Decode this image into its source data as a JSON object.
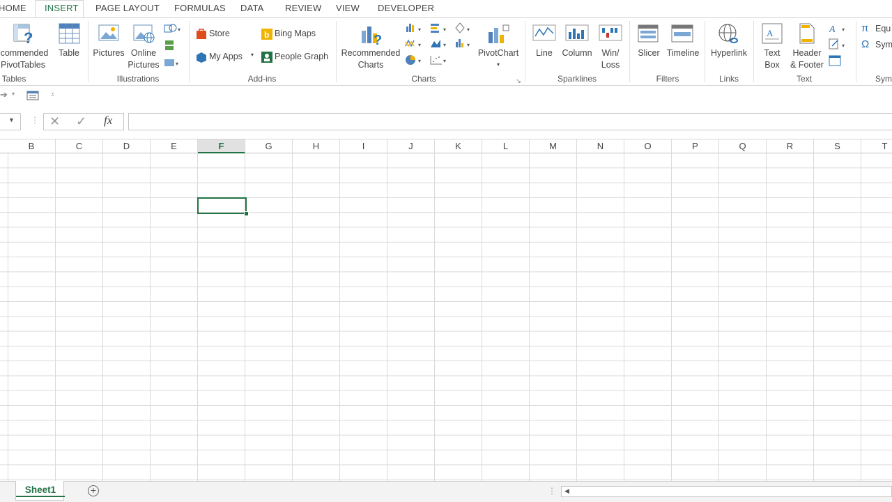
{
  "tabs": [
    "HOME",
    "INSERT",
    "PAGE LAYOUT",
    "FORMULAS",
    "DATA",
    "REVIEW",
    "VIEW",
    "DEVELOPER"
  ],
  "active_tab": "INSERT",
  "colors": {
    "accent": "#217346",
    "ribbon_bg": "#ffffff",
    "grid_line": "#dadada"
  },
  "ribbon": {
    "tables": {
      "label": "Tables",
      "recommended_pivot": [
        "commended",
        "PivotTables"
      ],
      "table": "Table"
    },
    "illustrations": {
      "label": "Illustrations",
      "pictures": "Pictures",
      "online_pictures": [
        "Online",
        "Pictures"
      ]
    },
    "addins": {
      "label": "Add-ins",
      "store": "Store",
      "my_apps": "My Apps",
      "bing_maps": "Bing Maps",
      "people_graph": "People Graph"
    },
    "charts": {
      "label": "Charts",
      "recommended": [
        "Recommended",
        "Charts"
      ],
      "pivotchart": "PivotChart"
    },
    "sparklines": {
      "label": "Sparklines",
      "line": "Line",
      "column": "Column",
      "winloss": [
        "Win/",
        "Loss"
      ]
    },
    "filters": {
      "label": "Filters",
      "slicer": "Slicer",
      "timeline": "Timeline"
    },
    "links": {
      "label": "Links",
      "hyperlink": "Hyperlink"
    },
    "text": {
      "label": "Text",
      "textbox": [
        "Text",
        "Box"
      ],
      "header_footer": [
        "Header",
        "& Footer"
      ]
    },
    "symbols": {
      "label": "Sym",
      "equation": "Equ",
      "symbol": "Sym"
    }
  },
  "formula_bar": {
    "fx_label": "fx",
    "value": ""
  },
  "columns": [
    "B",
    "C",
    "D",
    "E",
    "F",
    "G",
    "H",
    "I",
    "J",
    "K",
    "L",
    "M",
    "N",
    "O",
    "P",
    "Q",
    "R",
    "S",
    "T"
  ],
  "selected_column": "F",
  "sheets": [
    "Sheet1"
  ],
  "icons": [
    "pivot-table-icon",
    "table-icon",
    "pictures-icon",
    "online-pictures-icon",
    "shapes-icon",
    "smartart-icon",
    "screenshot-icon",
    "store-icon",
    "my-apps-icon",
    "bing-maps-icon",
    "people-graph-icon",
    "recommended-charts-icon",
    "pivotchart-icon",
    "line-sparkline-icon",
    "column-sparkline-icon",
    "winloss-sparkline-icon",
    "slicer-icon",
    "timeline-icon",
    "hyperlink-icon",
    "textbox-icon",
    "header-footer-icon",
    "cancel-icon",
    "enter-icon",
    "add-sheet-icon"
  ]
}
